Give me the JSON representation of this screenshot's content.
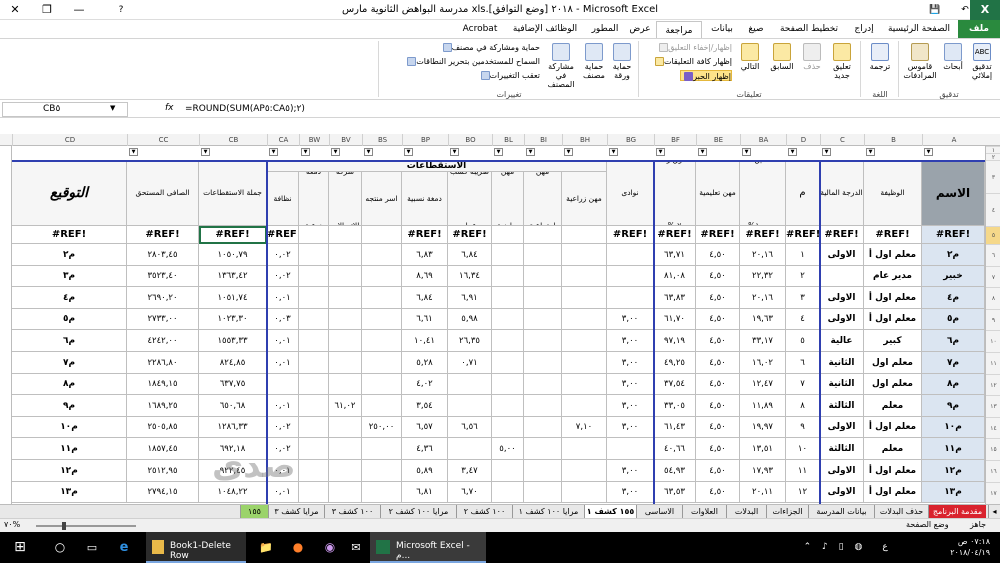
{
  "window": {
    "title": "مدرسة البواهض الثانوية مارس xls.٢٠١٨ [وضع التوافق] - Microsoft Excel",
    "controls": {
      "close": "✕",
      "restore": "❐",
      "minimize": "—",
      "help": "?"
    }
  },
  "ribbon_tabs": [
    "ملف",
    "الصفحة الرئيسية",
    "إدراج",
    "تخطيط الصفحة",
    "صيغ",
    "بيانات",
    "مراجعة",
    "عرض",
    "المطور",
    "الوظائف الإضافية",
    "Acrobat"
  ],
  "ribbon": {
    "proofing": {
      "group": "تدقيق",
      "buttons": [
        "تدقيق إملائي",
        "أبحاث",
        "قاموس المرادفات"
      ]
    },
    "language": {
      "group": "اللغة",
      "buttons": [
        "ترجمة"
      ]
    },
    "comments": {
      "group": "تعليقات",
      "buttons": [
        "تعليق جديد",
        "حذف",
        "السابق",
        "التالي"
      ],
      "small": [
        "إظهار/إخفاء التعليق",
        "إظهار كافة التعليقات",
        "إظهار الحبر"
      ]
    },
    "changes": {
      "group": "تغييرات",
      "buttons": [
        "حماية ورقة",
        "حماية مصنف",
        "مشاركة في المصنف"
      ],
      "small": [
        "حماية ومشاركة في مصنف",
        "السماح للمستخدمين بتحرير النطاقات",
        "تعقب التغييرات"
      ]
    }
  },
  "formula_bar": {
    "name_box": "CB٥",
    "formula": "=ROUND(SUM(AP٥:CA٥);٢)",
    "fx": "fx"
  },
  "columns": [
    "CD",
    "CC",
    "CB",
    "CA",
    "BW",
    "BV",
    "BS",
    "BP",
    "BO",
    "BL",
    "BI",
    "BH",
    "BG",
    "BF",
    "BE",
    "BA",
    "D",
    "C",
    "B",
    "A"
  ],
  "row_numbers": [
    "١",
    "٢",
    "٣",
    "٤",
    "٥",
    "٦",
    "٧",
    "٨",
    "٩",
    "١٠",
    "١١",
    "١٢",
    "١٣",
    "١٤",
    "١٥",
    "١٦",
    "١٧"
  ],
  "headers": {
    "name": "الاسم",
    "job": "الوظيفة",
    "grade": "الدرجة المالية",
    "seq": "م",
    "health": "تامين صحي١%",
    "educational": "مهن تعليمية",
    "fund": "صندوق زماله ٧ %",
    "clubs": "نوادى",
    "agricultural": "مهن زراعية",
    "social": "مهن اجتماعية",
    "sports": "مهن رياضية",
    "tax": "ضريبة كسب عمل",
    "relative": "دمغة نسبية",
    "family": "اسر منتجه",
    "telecom": "شركة الاتصالات",
    "stamp": "دمغة نوعية",
    "cleaning": "نظافة",
    "total_deductions": "جملة الاستقطاعات",
    "net": "الصافى المستحق",
    "signature": "التوقيع",
    "deductions_band": "الاستقطاعات"
  },
  "ref_error": "#REF!",
  "rows": [
    {
      "name": "م٢",
      "job": "معلم اول أ",
      "grade": "الاولى",
      "seq": "١",
      "health": "٢٠,١٦",
      "edu": "٤,٥٠",
      "fund": "٦٣,٧١",
      "clubs": "",
      "agri": "",
      "social": "",
      "sports": "",
      "tax": "٦,٨٤",
      "relative": "٦,٨٣",
      "family": "",
      "telecom": "",
      "stamp": "",
      "clean": "٠,٠٢",
      "total": "١٠٥٠,٧٩",
      "net": "٢٨٠٣,٤٥",
      "sig": "م٢"
    },
    {
      "name": "خبير",
      "job": "مدير عام",
      "grade": "",
      "seq": "٢",
      "health": "٢٢,٣٢",
      "edu": "٤,٥٠",
      "fund": "٨١,٠٨",
      "clubs": "",
      "agri": "",
      "social": "",
      "sports": "",
      "tax": "١٦,٣٤",
      "relative": "٨,٦٩",
      "family": "",
      "telecom": "",
      "stamp": "",
      "clean": "٠,٠٢",
      "total": "١٣٦٣,٤٢",
      "net": "٣٥٢٣,٤٠",
      "sig": "م٣"
    },
    {
      "name": "م٤",
      "job": "معلم اول أ",
      "grade": "الاولى",
      "seq": "٣",
      "health": "٢٠,١٦",
      "edu": "٤,٥٠",
      "fund": "٦٣,٨٣",
      "clubs": "",
      "agri": "",
      "social": "",
      "sports": "",
      "tax": "٦,٩١",
      "relative": "٦,٨٤",
      "family": "",
      "telecom": "",
      "stamp": "",
      "clean": "٠,٠١",
      "total": "١٠٥١,٧٤",
      "net": "٢٦٩٠,٢٠",
      "sig": "م٤"
    },
    {
      "name": "م٥",
      "job": "معلم اول أ",
      "grade": "الاولى",
      "seq": "٤",
      "health": "١٩,٦٣",
      "edu": "٤,٥٠",
      "fund": "٦١,٧٠",
      "clubs": "٣,٠٠",
      "agri": "",
      "social": "",
      "sports": "",
      "tax": "٥,٩٨",
      "relative": "٦,٦١",
      "family": "",
      "telecom": "",
      "stamp": "",
      "clean": "٠,٠٣",
      "total": "١٠٢٣,٣٠",
      "net": "٢٧٣٣,٠٠",
      "sig": "م٥"
    },
    {
      "name": "م٦",
      "job": "كبير",
      "grade": "عالية",
      "seq": "٥",
      "health": "٣٣,١٧",
      "edu": "٤,٥٠",
      "fund": "٩٧,١٩",
      "clubs": "٣,٠٠",
      "agri": "",
      "social": "",
      "sports": "",
      "tax": "٢٦,٣٥",
      "relative": "١٠,٤١",
      "family": "",
      "telecom": "",
      "stamp": "",
      "clean": "٠,٠١",
      "total": "١٥٥٣,٣٣",
      "net": "٤٢٤٢,٠٠",
      "sig": "م٦"
    },
    {
      "name": "م٧",
      "job": "معلم اول",
      "grade": "الثانية",
      "seq": "٦",
      "health": "١٦,٠٢",
      "edu": "٤,٥٠",
      "fund": "٤٩,٢٥",
      "clubs": "٣,٠٠",
      "agri": "",
      "social": "",
      "sports": "",
      "tax": "٠,٧١",
      "relative": "٥,٢٨",
      "family": "",
      "telecom": "",
      "stamp": "",
      "clean": "٠,٠١",
      "total": "٨٢٤,٨٥",
      "net": "٢٢٨٦,٨٠",
      "sig": "م٧"
    },
    {
      "name": "م٨",
      "job": "معلم اول",
      "grade": "الثانية",
      "seq": "٧",
      "health": "١٢,٤٧",
      "edu": "٤,٥٠",
      "fund": "٣٧,٥٤",
      "clubs": "٣,٠٠",
      "agri": "",
      "social": "",
      "sports": "",
      "tax": "",
      "relative": "٤,٠٢",
      "family": "",
      "telecom": "",
      "stamp": "",
      "clean": "",
      "total": "٦٣٧,٧٥",
      "net": "١٨٤٩,١٥",
      "sig": "م٨"
    },
    {
      "name": "م٩",
      "job": "معلم",
      "grade": "الثالثة",
      "seq": "٨",
      "health": "١١,٨٩",
      "edu": "٤,٥٠",
      "fund": "٣٣,٠٥",
      "clubs": "٣,٠٠",
      "agri": "",
      "social": "",
      "sports": "",
      "tax": "",
      "relative": "٣,٥٤",
      "family": "",
      "telecom": "٦١,٠٢",
      "stamp": "",
      "clean": "٠,٠١",
      "total": "٦٥٠,٦٨",
      "net": "١٦٨٩,٢٥",
      "sig": "م٩"
    },
    {
      "name": "م١٠",
      "job": "معلم اول أ",
      "grade": "الاولى",
      "seq": "٩",
      "health": "١٩,٩٧",
      "edu": "٤,٥٠",
      "fund": "٦١,٤٣",
      "clubs": "٣,٠٠",
      "agri": "٧,١٠",
      "social": "",
      "sports": "",
      "tax": "٦,٥٦",
      "relative": "٦,٥٧",
      "family": "٢٥٠,٠٠",
      "telecom": "",
      "stamp": "",
      "clean": "٠,٠٢",
      "total": "١٢٨٦,٣٣",
      "net": "٢٥٠٥,٨٥",
      "sig": "م١٠"
    },
    {
      "name": "م١١",
      "job": "معلم",
      "grade": "الثالثة",
      "seq": "١٠",
      "health": "١٣,٥١",
      "edu": "٤,٥٠",
      "fund": "٤٠,٦٦",
      "clubs": "",
      "agri": "",
      "social": "",
      "sports": "٥,٠٠",
      "tax": "",
      "relative": "٤,٣٦",
      "family": "",
      "telecom": "",
      "stamp": "",
      "clean": "٠,٠٢",
      "total": "٦٩٢,١٨",
      "net": "١٨٥٧,٤٥",
      "sig": "م١١"
    },
    {
      "name": "م١٢",
      "job": "معلم اول أ",
      "grade": "الاولى",
      "seq": "١١",
      "health": "١٧,٩٣",
      "edu": "٤,٥٠",
      "fund": "٥٤,٩٣",
      "clubs": "٣,٠٠",
      "agri": "",
      "social": "",
      "sports": "",
      "tax": "٣,٤٧",
      "relative": "٥,٨٩",
      "family": "",
      "telecom": "",
      "stamp": "",
      "clean": "٠,٠١",
      "total": "٩٢٢,٤٥",
      "net": "٢٥١٢,٩٥",
      "sig": "م١٢"
    },
    {
      "name": "م١٣",
      "job": "معلم اول أ",
      "grade": "الاولى",
      "seq": "١٢",
      "health": "٢٠,١١",
      "edu": "٤,٥٠",
      "fund": "٦٣,٥٣",
      "clubs": "٣,٠٠",
      "agri": "",
      "social": "",
      "sports": "",
      "tax": "٦,٧٠",
      "relative": "٦,٨١",
      "family": "",
      "telecom": "",
      "stamp": "",
      "clean": "٠,٠١",
      "total": "١٠٤٨,٢٢",
      "net": "٢٧٩٤,١٥",
      "sig": "م١٣"
    }
  ],
  "sheet_tabs": [
    "مقدمة البرنامج",
    "حذف البدلات",
    "بيانات المدرسة",
    "الجزاءات",
    "البدلات",
    "العلاوات",
    "الاساسى",
    "١٥٥ كشف ١",
    "مرايا ١٠٠ كشف ١",
    "١٠٠ كشف ٢",
    "مرايا ١٠٠ كشف ٢",
    "١٠٠ كشف ٣",
    "مرايا كشف ٣",
    "١٥٥"
  ],
  "status": {
    "mode": "جاهز",
    "page_mode": "وضع الصفحة",
    "zoom": "٧٠%"
  },
  "taskbar": {
    "items": [
      "Book1-Delete Row",
      "Microsoft Excel - م..."
    ],
    "time": "٠٧:١٨ ص",
    "date": "٢٠١٨/٠٤/١٩",
    "lang": "ع"
  },
  "watermark": "صدى"
}
